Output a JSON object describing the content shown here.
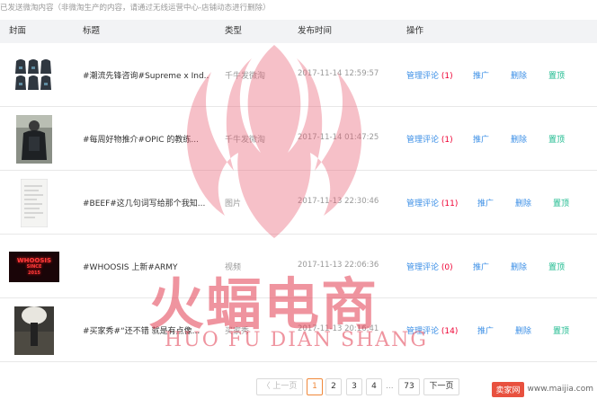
{
  "notice": "已发送微淘内容（非微淘生产的内容，请通过无线运营中心-店铺动态进行删除）",
  "columns": {
    "cover": "封面",
    "title": "标题",
    "type": "类型",
    "published": "发布时间",
    "actions": "操作"
  },
  "rows": [
    {
      "title": "#潮流先锋咨询#Supreme x Ind...",
      "type": "千牛发微淘",
      "date": "2017-11-14 12:59:57",
      "manage_label": "管理评论",
      "comment_count": "(1)",
      "promote": "推广",
      "delete": "删除",
      "pin": "置顶"
    },
    {
      "title": "#每周好物推介#OPIC 的教练...",
      "type": "千牛发微淘",
      "date": "2017-11-14 01:47:25",
      "manage_label": "管理评论",
      "comment_count": "(1)",
      "promote": "推广",
      "delete": "删除",
      "pin": "置顶"
    },
    {
      "title": "#BEEF#这几句词写给那个我知...",
      "type": "图片",
      "date": "2017-11-13 22:30:46",
      "manage_label": "管理评论",
      "comment_count": "(11)",
      "promote": "推广",
      "delete": "删除",
      "pin": "置顶"
    },
    {
      "title": "#WHOOSIS 上新#ARMY",
      "type": "视频",
      "date": "2017-11-13 22:06:36",
      "manage_label": "管理评论",
      "comment_count": "(0)",
      "promote": "推广",
      "delete": "删除",
      "pin": "置顶"
    },
    {
      "title": "#买家秀#“还不错 就是有点像...",
      "type": "买家秀",
      "date": "2017-11-13 20:16:41",
      "manage_label": "管理评论",
      "comment_count": "(14)",
      "promote": "推广",
      "delete": "删除",
      "pin": "置顶"
    }
  ],
  "neon_sign": {
    "line1": "WHOOSIS",
    "line2": "SINCE",
    "line3": "2015"
  },
  "pagination": {
    "prev": "〈 上一页",
    "pages": [
      "1",
      "2",
      "3",
      "4"
    ],
    "ellipsis": "...",
    "last_page": "73",
    "next": "下一页",
    "current": "1"
  },
  "watermark": {
    "cn": "火蝠电商",
    "en": "HUO FU DIAN SHANG",
    "site_logo": "卖家网",
    "site_url": "www.maijia.com"
  }
}
